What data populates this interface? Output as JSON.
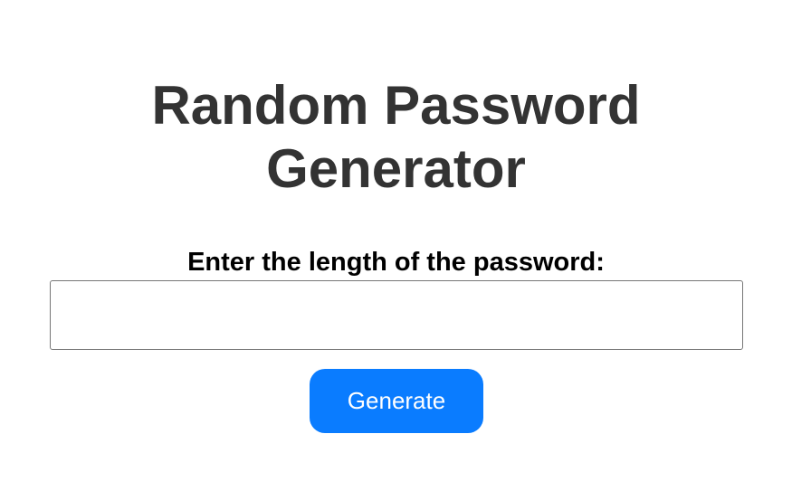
{
  "page": {
    "title_line1": "Random Password",
    "title_line2": "Generator"
  },
  "form": {
    "length_label": "Enter the length of the password:",
    "length_input_value": "",
    "length_input_placeholder": "",
    "generate_label": "Generate"
  },
  "colors": {
    "title": "#333333",
    "label": "#000000",
    "button_background": "#0a7cff",
    "button_text": "#ffffff",
    "input_border": "#767676"
  }
}
